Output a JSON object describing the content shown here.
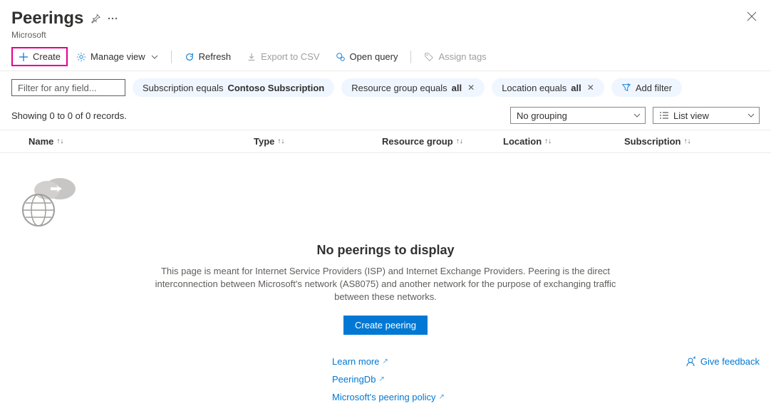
{
  "header": {
    "title": "Peerings",
    "subtitle": "Microsoft"
  },
  "toolbar": {
    "create": "Create",
    "manage_view": "Manage view",
    "refresh": "Refresh",
    "export_csv": "Export to CSV",
    "open_query": "Open query",
    "assign_tags": "Assign tags"
  },
  "filters": {
    "placeholder": "Filter for any field...",
    "pills": [
      {
        "prefix": "Subscription equals ",
        "value": "Contoso Subscription",
        "closable": false
      },
      {
        "prefix": "Resource group equals ",
        "value": "all",
        "closable": true
      },
      {
        "prefix": "Location equals ",
        "value": "all",
        "closable": true
      }
    ],
    "add_filter": "Add filter"
  },
  "summary": {
    "records": "Showing 0 to 0 of 0 records.",
    "grouping": "No grouping",
    "view": "List view"
  },
  "columns": {
    "name": "Name",
    "type": "Type",
    "rg": "Resource group",
    "loc": "Location",
    "sub": "Subscription"
  },
  "empty": {
    "title": "No peerings to display",
    "desc": "This page is meant for Internet Service Providers (ISP) and Internet Exchange Providers. Peering is the direct interconnection between Microsoft's network (AS8075) and another network for the purpose of exchanging traffic between these networks.",
    "cta": "Create peering"
  },
  "links": {
    "learn": "Learn more",
    "peeringdb": "PeeringDb",
    "policy": "Microsoft's peering policy",
    "feedback": "Give feedback"
  }
}
